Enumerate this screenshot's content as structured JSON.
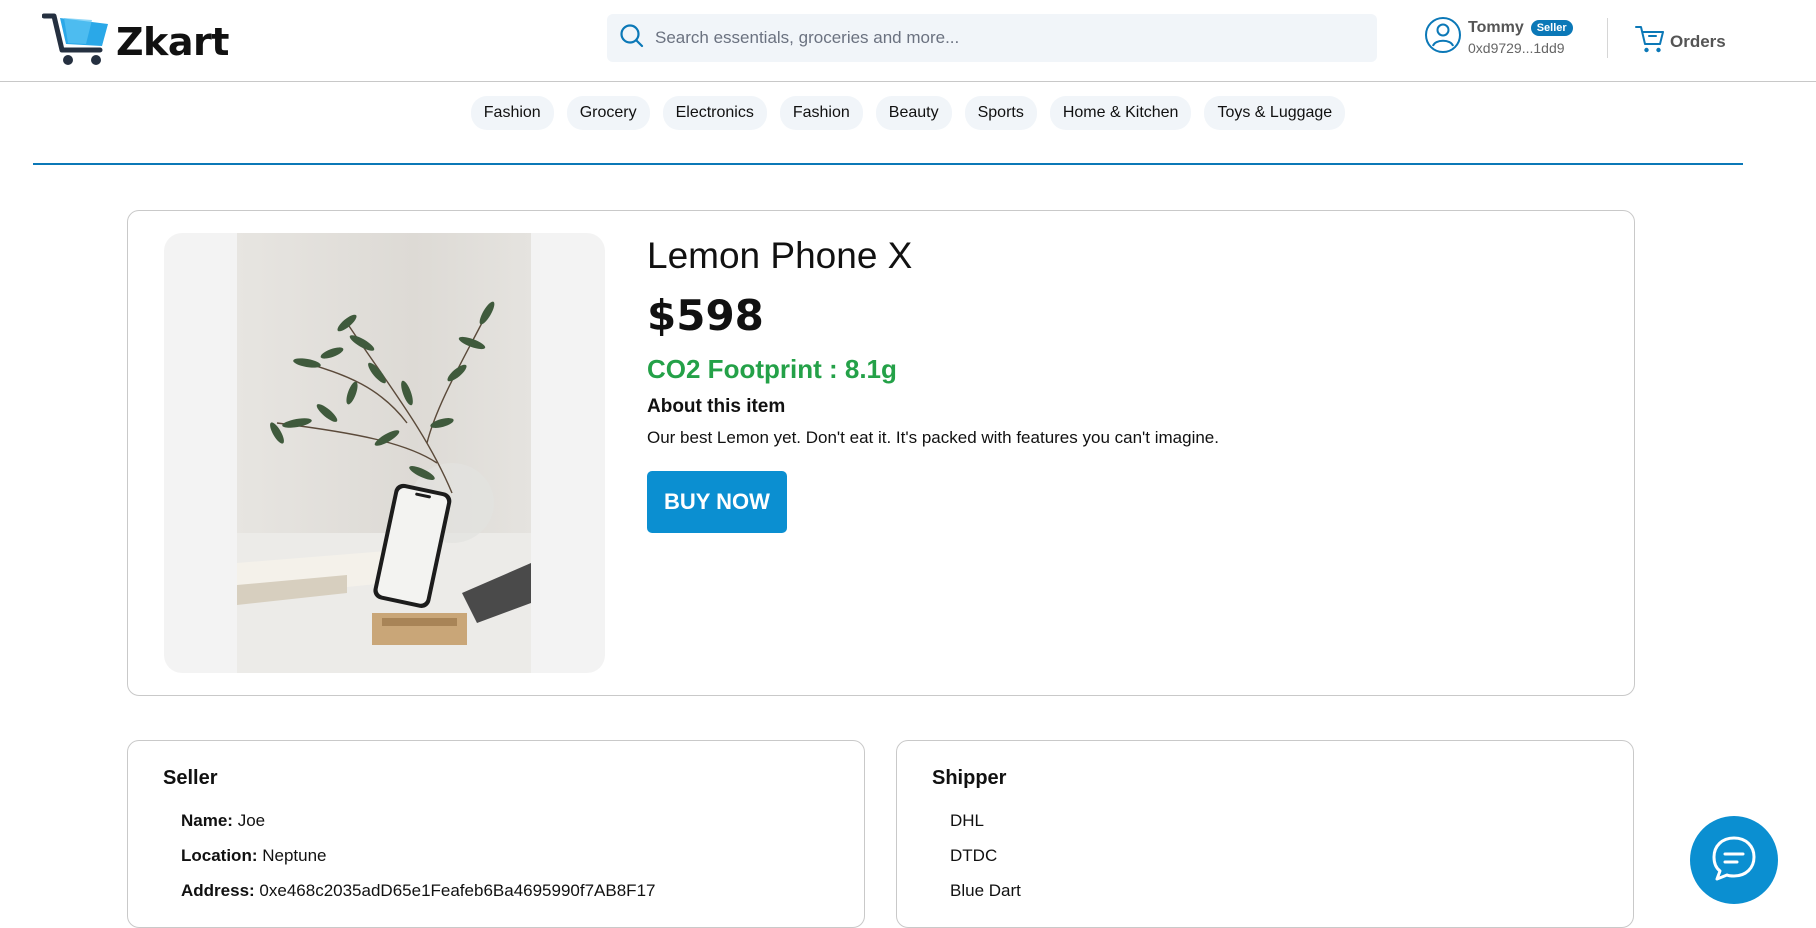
{
  "header": {
    "logo_text": "Zkart",
    "search_placeholder": "Search essentials, groceries and more...",
    "user": {
      "name": "Tommy",
      "badge": "Seller",
      "address": "0xd9729...1dd9"
    },
    "orders_label": "Orders"
  },
  "nav": {
    "categories": [
      "Fashion",
      "Grocery",
      "Electronics",
      "Fashion",
      "Beauty",
      "Sports",
      "Home & Kitchen",
      "Toys & Luggage"
    ]
  },
  "product": {
    "title": "Lemon Phone X",
    "price": "$598",
    "co2": "CO2 Footprint : 8.1g",
    "about_heading": "About this item",
    "about_text": "Our best Lemon yet. Don't eat it. It's packed with features you can't imagine.",
    "buy_label": "BUY NOW"
  },
  "seller": {
    "heading": "Seller",
    "name_label": "Name:",
    "name_value": "Joe",
    "location_label": "Location:",
    "location_value": "Neptune",
    "address_label": "Address:",
    "address_value": "0xe468c2035adD65e1Feafeb6Ba4695990f7AB8F17"
  },
  "shipper": {
    "heading": "Shipper",
    "options": [
      "DHL",
      "DTDC",
      "Blue Dart"
    ]
  },
  "colors": {
    "brand_blue": "#0b8fd1",
    "co2_green": "#24a148",
    "badge_blue": "#0b78b7"
  },
  "icons": {
    "logo": "shopping-cart-icon",
    "search": "search-icon",
    "user": "user-icon",
    "orders": "cart-icon",
    "chat": "chat-bubble-icon"
  }
}
